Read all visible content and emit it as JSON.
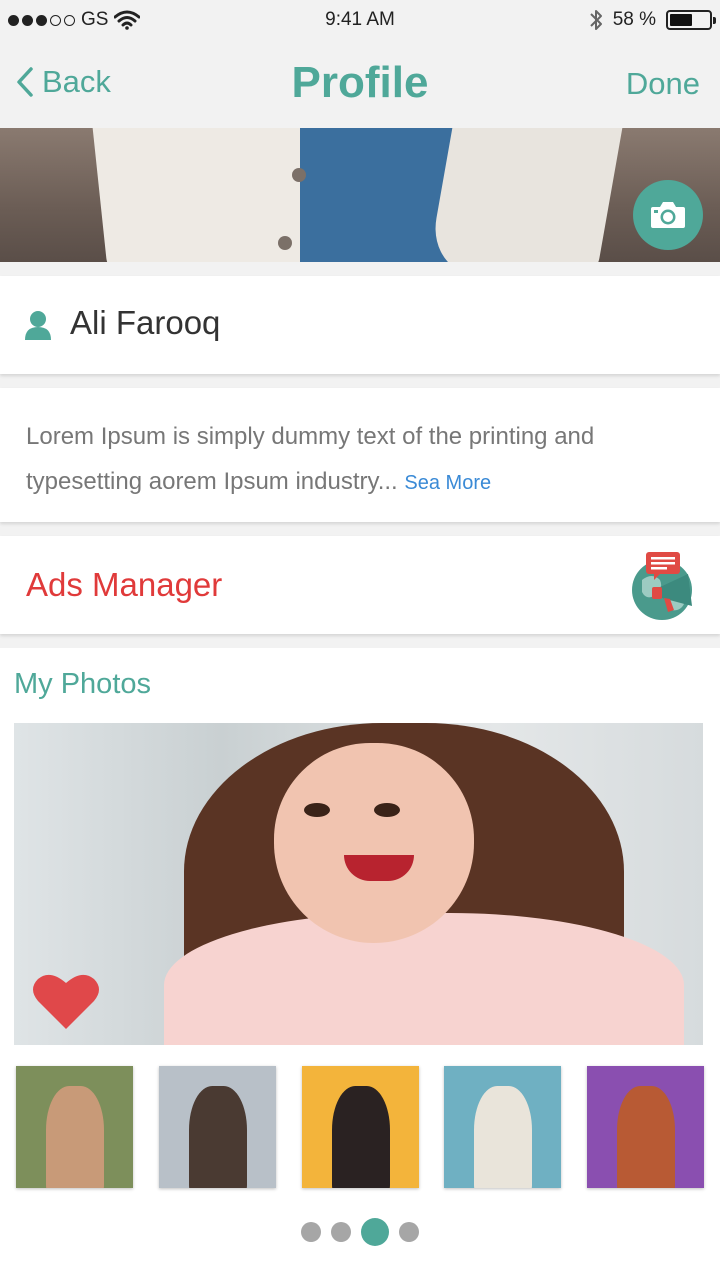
{
  "status_bar": {
    "carrier": "GS",
    "time": "9:41 AM",
    "battery_text": "58 %",
    "battery_level": 0.58,
    "signal_icon": "signal-dots-icon",
    "wifi_icon": "wifi-icon",
    "bluetooth_icon": "bluetooth-icon"
  },
  "nav": {
    "back_label": "Back",
    "title": "Profile",
    "done_label": "Done"
  },
  "cover": {
    "camera_icon": "camera-icon"
  },
  "profile": {
    "name": "Ali Farooq",
    "bio": "Lorem Ipsum is simply dummy text of the printing and typesetting aorem Ipsum industry...",
    "see_more": "Sea More"
  },
  "ads": {
    "label": "Ads Manager",
    "icon": "megaphone-globe-icon"
  },
  "photos": {
    "title": "My Photos",
    "main_favorite_icon": "heart-icon",
    "thumbnails": [
      {
        "bg": "#7d8f5b"
      },
      {
        "bg": "#b8c0c8"
      },
      {
        "bg": "#f3b43b"
      },
      {
        "bg": "#6fb0c2"
      },
      {
        "bg": "#8a4fb0"
      }
    ],
    "pager": {
      "pages": 4,
      "active": 3
    }
  },
  "colors": {
    "accent": "#4fa899",
    "ads_red": "#e03a3a",
    "link_blue": "#3a8ad6"
  }
}
